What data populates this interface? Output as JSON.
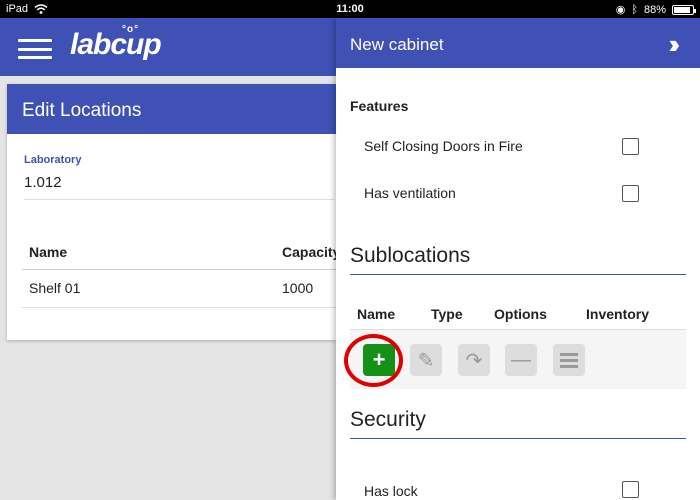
{
  "status_bar": {
    "carrier": "iPad",
    "time": "11:00",
    "battery": "88%",
    "battery_level": 0.88
  },
  "app": {
    "logo": "labcup"
  },
  "edit_locations": {
    "title": "Edit Locations",
    "laboratory_label": "Laboratory",
    "laboratory_value": "1.012",
    "table": {
      "columns": [
        "Name",
        "Capacity"
      ],
      "rows": [
        {
          "name": "Shelf 01",
          "capacity": "1000"
        }
      ]
    }
  },
  "panel": {
    "title": "New cabinet",
    "features": {
      "heading": "Features",
      "options": [
        {
          "label": "Self Closing Doors in Fire",
          "checked": false
        },
        {
          "label": "Has ventilation",
          "checked": false
        }
      ]
    },
    "sublocations": {
      "heading": "Sublocations",
      "columns": [
        "Name",
        "Type",
        "Options",
        "Inventory"
      ],
      "actions": [
        "add",
        "edit",
        "move",
        "remove",
        "list"
      ]
    },
    "security": {
      "heading": "Security",
      "options": [
        {
          "label": "Has lock",
          "checked": false
        }
      ]
    }
  },
  "colors": {
    "primary": "#3f51b5",
    "add_button": "#179017",
    "highlight_ring": "#e00000"
  }
}
